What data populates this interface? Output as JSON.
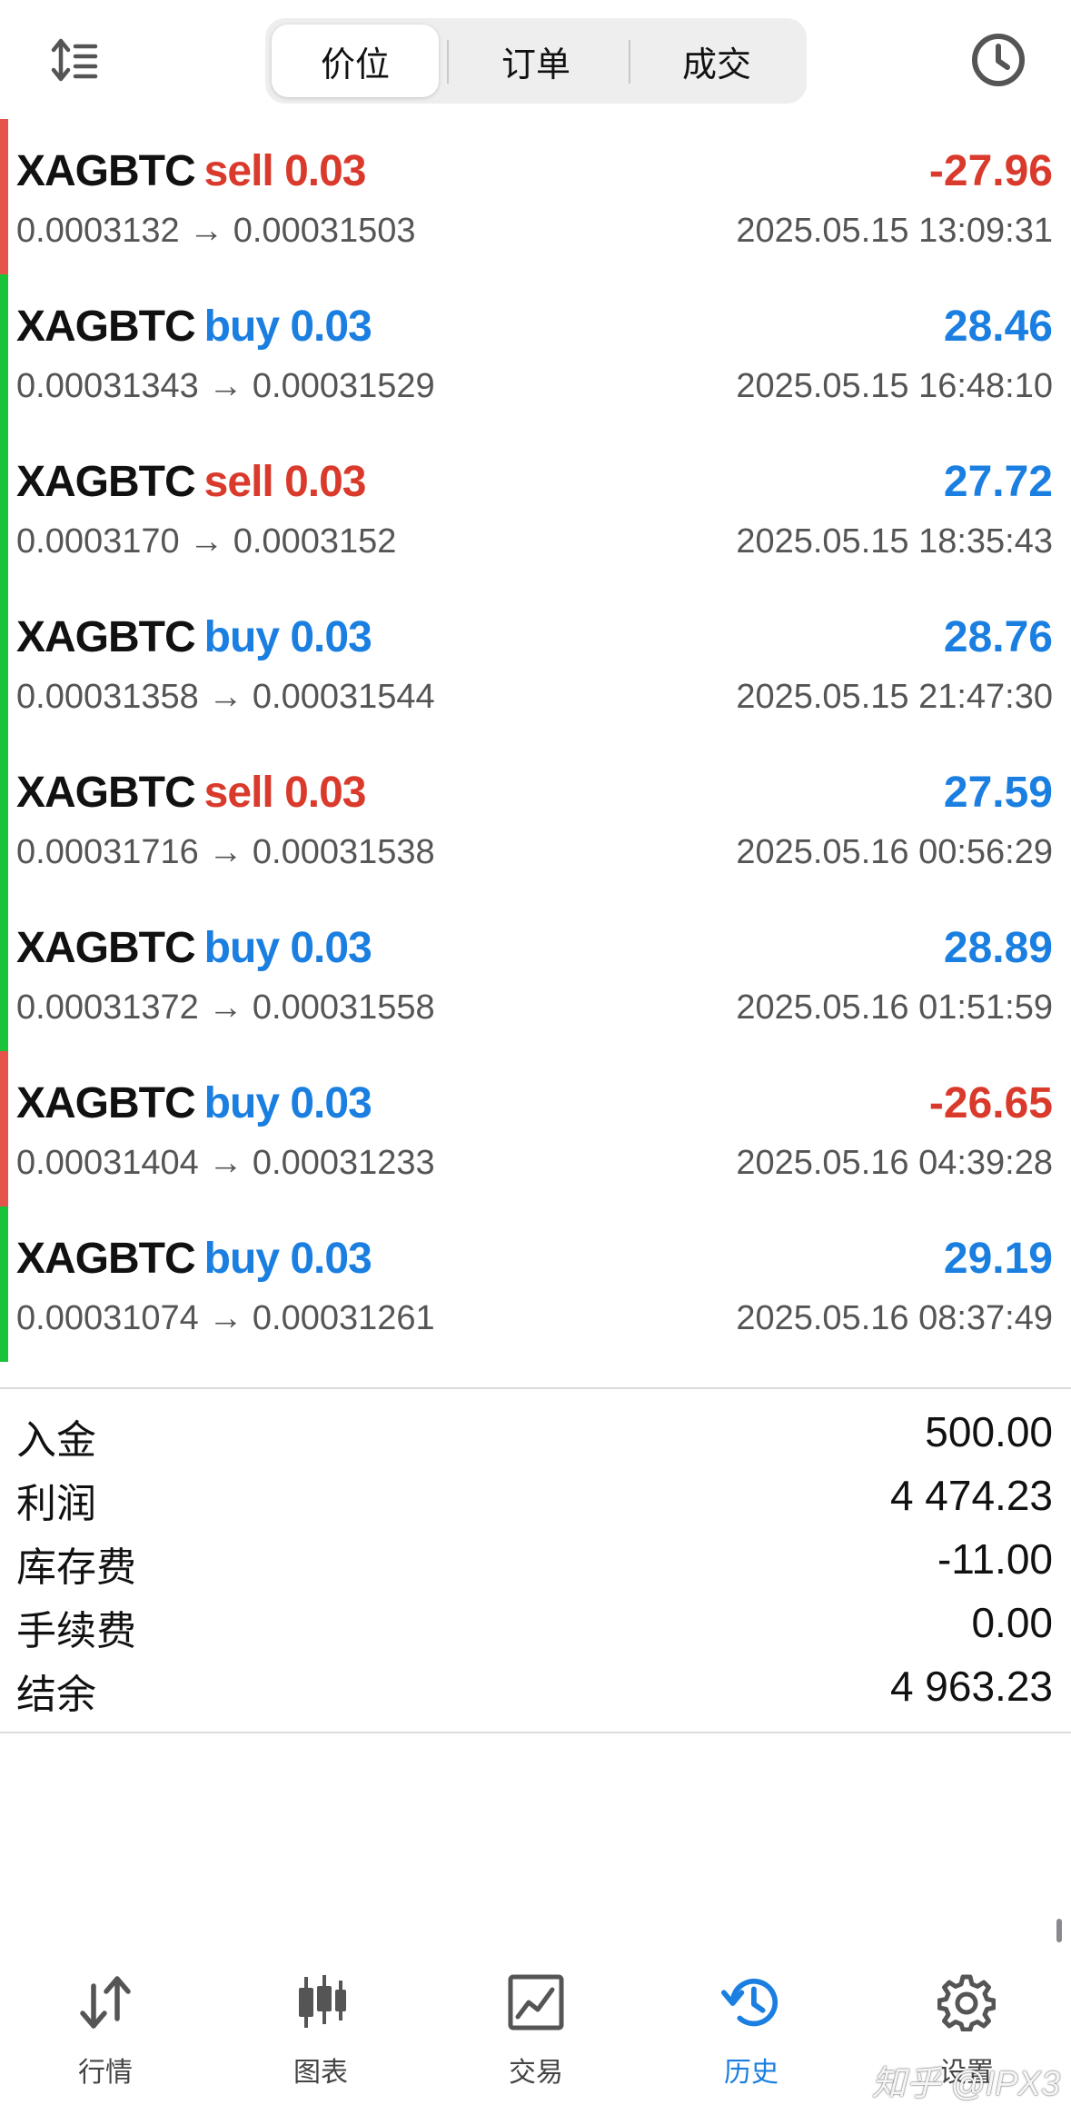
{
  "header": {
    "sort_icon": "sort-icon",
    "history_icon": "clock-icon",
    "tabs": [
      {
        "label": "价位",
        "active": true
      },
      {
        "label": "订单",
        "active": false
      },
      {
        "label": "成交",
        "active": false
      }
    ]
  },
  "colors": {
    "loss": "#d93a2b",
    "profit": "#1a7fe0",
    "bar_loss": "#e5534b",
    "bar_profit": "#19c43a",
    "active_tab": "#1a7fe0"
  },
  "deals": [
    {
      "symbol": "XAGBTC",
      "side": "sell 0.03",
      "profit": "-27.96",
      "prices": "0.0003132 → 0.00031503",
      "time": "2025.05.15 13:09:31"
    },
    {
      "symbol": "XAGBTC",
      "side": "buy 0.03",
      "profit": "28.46",
      "prices": "0.00031343 → 0.00031529",
      "time": "2025.05.15 16:48:10"
    },
    {
      "symbol": "XAGBTC",
      "side": "sell 0.03",
      "profit": "27.72",
      "prices": "0.0003170 → 0.0003152",
      "time": "2025.05.15 18:35:43"
    },
    {
      "symbol": "XAGBTC",
      "side": "buy 0.03",
      "profit": "28.76",
      "prices": "0.00031358 → 0.00031544",
      "time": "2025.05.15 21:47:30"
    },
    {
      "symbol": "XAGBTC",
      "side": "sell 0.03",
      "profit": "27.59",
      "prices": "0.00031716 → 0.00031538",
      "time": "2025.05.16 00:56:29"
    },
    {
      "symbol": "XAGBTC",
      "side": "buy 0.03",
      "profit": "28.89",
      "prices": "0.00031372 → 0.00031558",
      "time": "2025.05.16 01:51:59"
    },
    {
      "symbol": "XAGBTC",
      "side": "buy 0.03",
      "profit": "-26.65",
      "prices": "0.00031404 → 0.00031233",
      "time": "2025.05.16 04:39:28"
    },
    {
      "symbol": "XAGBTC",
      "side": "buy 0.03",
      "profit": "29.19",
      "prices": "0.00031074 → 0.00031261",
      "time": "2025.05.16 08:37:49"
    }
  ],
  "summary": [
    {
      "label": "入金",
      "value": "500.00"
    },
    {
      "label": "利润",
      "value": "4 474.23"
    },
    {
      "label": "库存费",
      "value": "-11.00"
    },
    {
      "label": "手续费",
      "value": "0.00"
    },
    {
      "label": "结余",
      "value": "4 963.23"
    }
  ],
  "tabbar": [
    {
      "label": "行情",
      "icon": "arrows-updown-icon",
      "active": false
    },
    {
      "label": "图表",
      "icon": "candlestick-icon",
      "active": false
    },
    {
      "label": "交易",
      "icon": "trade-chart-icon",
      "active": false
    },
    {
      "label": "历史",
      "icon": "history-icon",
      "active": true
    },
    {
      "label": "设置",
      "icon": "gear-icon",
      "active": false
    }
  ],
  "watermark": "知乎 @IPX3"
}
